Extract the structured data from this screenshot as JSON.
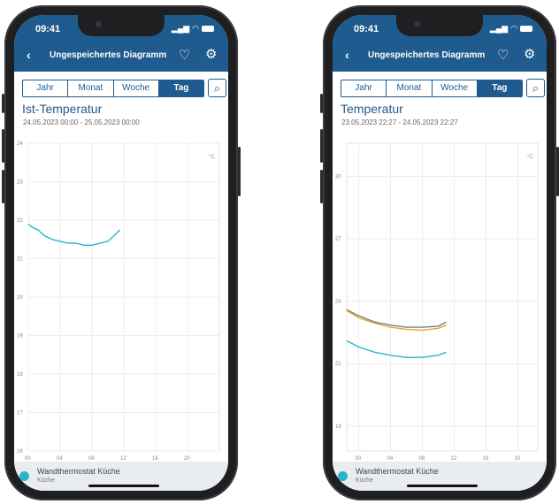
{
  "phones": [
    {
      "status_time": "09:41",
      "nav_title": "Ungespeichertes Diagramm",
      "tabs": [
        "Jahr",
        "Monat",
        "Woche",
        "Tag"
      ],
      "active_tab": "Tag",
      "chart_title": "Ist-Temperatur",
      "date_range": "24.05.2023 00:00 - 25.05.2023 00:00",
      "legend_name": "Wandthermostat Küche",
      "legend_room": "Küche"
    },
    {
      "status_time": "09:41",
      "nav_title": "Ungespeichertes Diagramm",
      "tabs": [
        "Jahr",
        "Monat",
        "Woche",
        "Tag"
      ],
      "active_tab": "Tag",
      "chart_title": "Temperatur",
      "date_range": "23.05.2023 22:27 - 24.05.2023 22:27",
      "legend_name": "Wandthermostat Küche",
      "legend_room": "Küche"
    }
  ],
  "chart_data": [
    {
      "type": "line",
      "unit": "°C",
      "x_ticks": [
        "00",
        "04",
        "08",
        "12",
        "16",
        "20"
      ],
      "x_range": [
        0,
        24
      ],
      "y_ticks": [
        16,
        17,
        18,
        19,
        20,
        21,
        22,
        23,
        24
      ],
      "y_range": [
        16,
        24
      ],
      "grid": true,
      "series": [
        {
          "color": "#27b5cc",
          "points": [
            [
              0,
              21.9
            ],
            [
              0.6,
              21.8
            ],
            [
              1.2,
              21.75
            ],
            [
              2,
              21.6
            ],
            [
              3,
              21.5
            ],
            [
              4,
              21.45
            ],
            [
              5,
              21.4
            ],
            [
              6,
              21.4
            ],
            [
              7,
              21.35
            ],
            [
              8,
              21.35
            ],
            [
              9,
              21.4
            ],
            [
              10,
              21.45
            ],
            [
              10.8,
              21.6
            ],
            [
              11.5,
              21.75
            ]
          ]
        }
      ]
    },
    {
      "type": "line",
      "unit": "°C",
      "x_ticks": [
        "00",
        "04",
        "08",
        "12",
        "16",
        "20"
      ],
      "x_range": [
        -1.5,
        22.5
      ],
      "y_ticks": [
        18,
        21,
        24,
        27,
        30
      ],
      "y_range": [
        16.8,
        31.6
      ],
      "grid": true,
      "series": [
        {
          "color": "#7a7f86",
          "points": [
            [
              -1.5,
              23.6
            ],
            [
              0,
              23.3
            ],
            [
              2,
              23.0
            ],
            [
              4,
              22.85
            ],
            [
              6,
              22.75
            ],
            [
              8,
              22.75
            ],
            [
              10,
              22.8
            ],
            [
              11,
              23.0
            ]
          ]
        },
        {
          "color": "#f2a41f",
          "points": [
            [
              -1.5,
              23.55
            ],
            [
              0,
              23.2
            ],
            [
              2,
              22.95
            ],
            [
              4,
              22.75
            ],
            [
              6,
              22.65
            ],
            [
              8,
              22.6
            ],
            [
              10,
              22.7
            ],
            [
              11,
              22.85
            ]
          ]
        },
        {
          "color": "#27b5cc",
          "points": [
            [
              -1.5,
              22.1
            ],
            [
              0,
              21.8
            ],
            [
              2,
              21.55
            ],
            [
              4,
              21.4
            ],
            [
              6,
              21.3
            ],
            [
              8,
              21.3
            ],
            [
              10,
              21.4
            ],
            [
              11,
              21.55
            ]
          ]
        }
      ]
    }
  ]
}
